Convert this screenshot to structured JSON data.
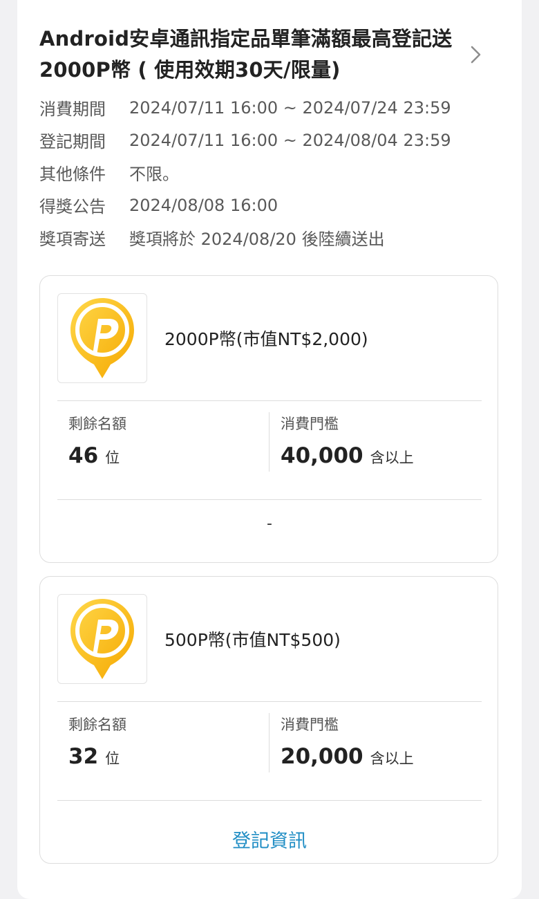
{
  "event": {
    "title": "Android安卓通訊指定品單筆滿額最高登記送2000P幣 ( 使用效期30天/限量)",
    "info": [
      {
        "label": "消費期間",
        "value": "2024/07/11 16:00 ~ 2024/07/24 23:59"
      },
      {
        "label": "登記期間",
        "value": "2024/07/11 16:00 ~ 2024/08/04 23:59"
      },
      {
        "label": "其他條件",
        "value": "不限。"
      },
      {
        "label": "得獎公告",
        "value": "2024/08/08 16:00"
      },
      {
        "label": "獎項寄送",
        "value": "獎項將於 2024/08/20 後陸續送出"
      }
    ]
  },
  "prizes": [
    {
      "name": "2000P幣(市值NT$2,000)",
      "icon": "p-coin-icon",
      "remaining_label": "剩餘名額",
      "remaining_value": "46",
      "remaining_unit": "位",
      "threshold_label": "消費門檻",
      "threshold_value": "40,000",
      "threshold_unit": "含以上",
      "footer": "-"
    },
    {
      "name": "500P幣(市值NT$500)",
      "icon": "p-coin-icon",
      "remaining_label": "剩餘名額",
      "remaining_value": "32",
      "remaining_unit": "位",
      "threshold_label": "消費門檻",
      "threshold_value": "20,000",
      "threshold_unit": "含以上",
      "footer": "登記資訊"
    }
  ],
  "colors": {
    "accent_link": "#1f8dc4",
    "coin_yellow": "#f7b500",
    "page_bg": "#f1f1f3"
  }
}
